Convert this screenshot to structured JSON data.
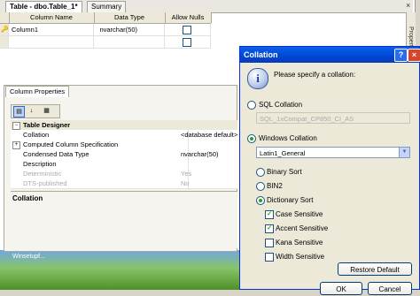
{
  "designer": {
    "tab_title": "Table - dbo.Table_1*",
    "tab_summary": "Summary",
    "close_glyph": "×",
    "grid": {
      "headers": [
        "Column Name",
        "Data Type",
        "Allow Nulls"
      ],
      "rows": [
        {
          "name": "Column1",
          "type": "nvarchar(50)",
          "allow_nulls": false
        }
      ]
    },
    "side_label": "Properties"
  },
  "properties": {
    "tab_label": "Column Properties",
    "section": "Table Designer",
    "rows": [
      {
        "name": "Collation",
        "value": "<database default>"
      },
      {
        "name": "Computed Column Specification",
        "value": ""
      },
      {
        "name": "Condensed Data Type",
        "value": "nvarchar(50)"
      },
      {
        "name": "Description",
        "value": ""
      },
      {
        "name": "Deterministic",
        "value": "Yes"
      },
      {
        "name": "DTS-published",
        "value": "No"
      }
    ],
    "description_title": "Collation"
  },
  "dialog": {
    "title": "Collation",
    "prompt": "Please specify a collation:",
    "sql_collation_label": "SQL Collation",
    "sql_collation_value": "SQL_1xCompat_CP850_CI_AS",
    "windows_collation_label": "Windows Collation",
    "windows_collation_value": "Latin1_General",
    "binary_sort_label": "Binary Sort",
    "bin2_label": "BIN2",
    "dictionary_sort_label": "Dictionary Sort",
    "case_sensitive_label": "Case Sensitive",
    "case_sensitive": true,
    "accent_sensitive_label": "Accent Sensitive",
    "accent_sensitive": true,
    "kana_sensitive_label": "Kana Sensitive",
    "kana_sensitive": false,
    "width_sensitive_label": "Width Sensitive",
    "width_sensitive": false,
    "restore_default_label": "Restore Default",
    "ok_label": "OK",
    "cancel_label": "Cancel",
    "help_glyph": "?",
    "close_glyph": "×"
  },
  "taskbar": {
    "label": "Winsetupf..."
  },
  "colors": {
    "title_bar": "#0046d5",
    "radio_dot": "#21a121"
  }
}
